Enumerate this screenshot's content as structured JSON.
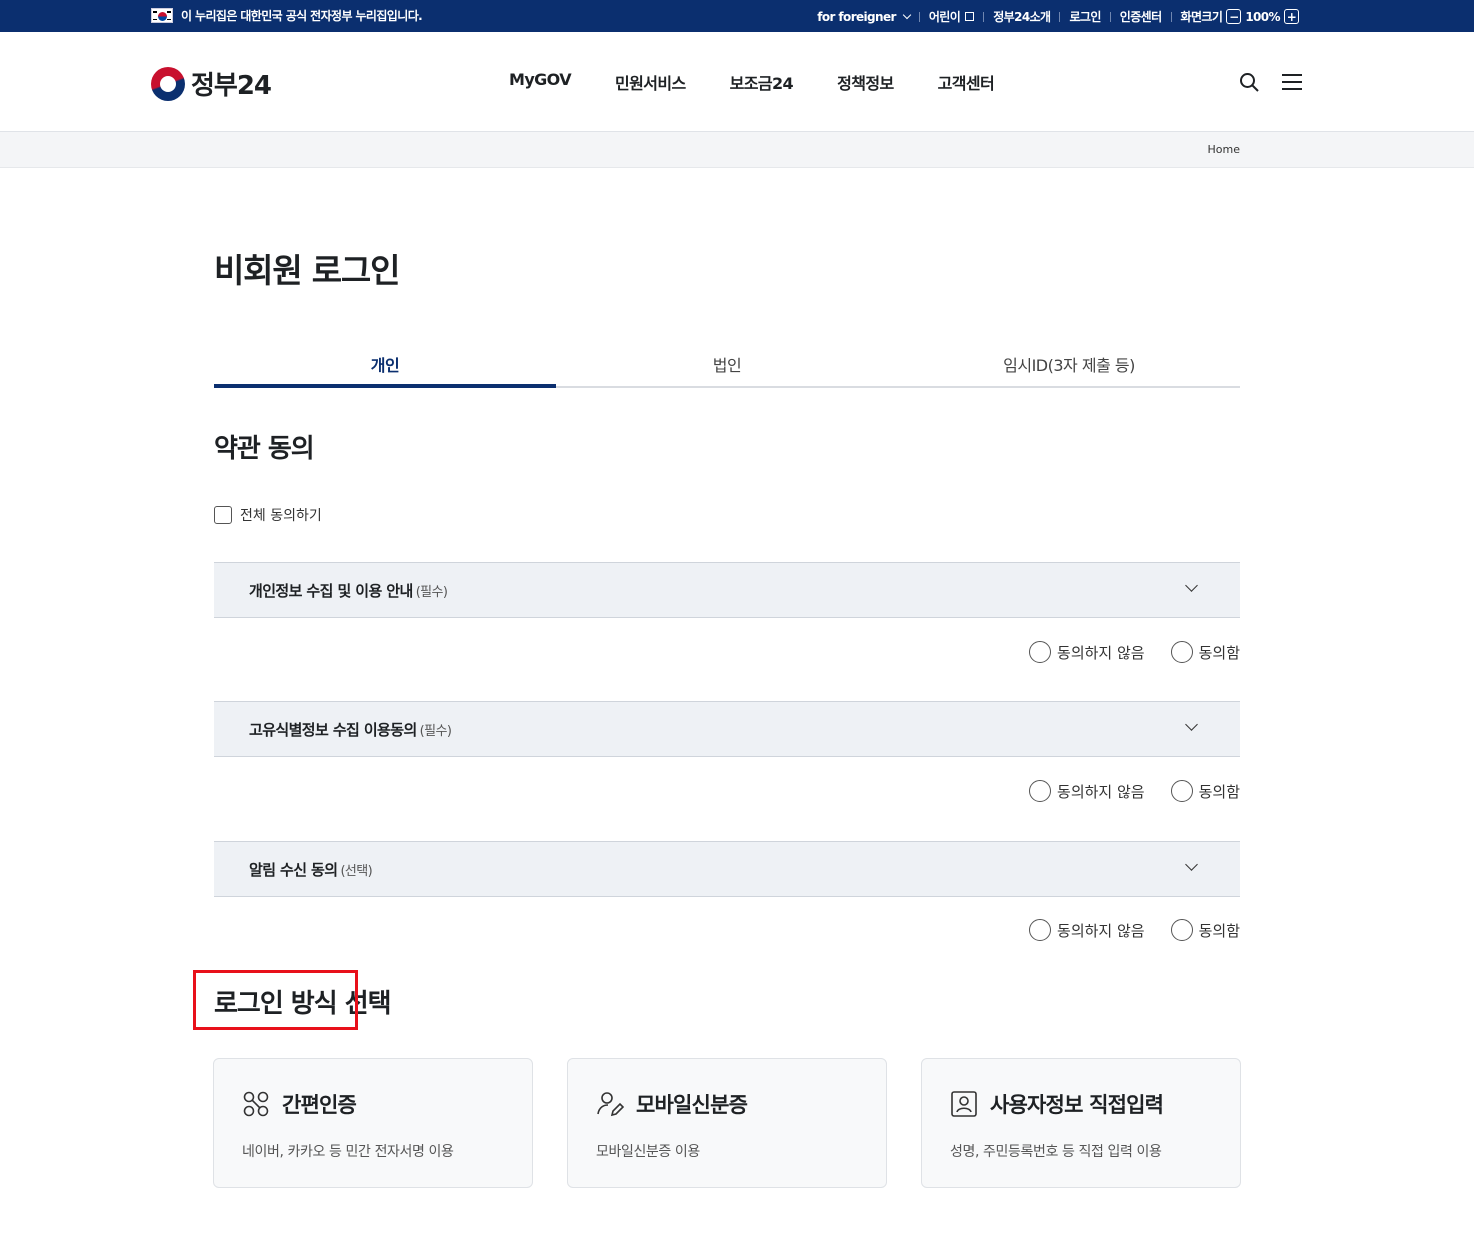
{
  "topbar": {
    "notice": "이 누리집은 대한민국 공식 전자정부 누리집입니다.",
    "links": [
      "for foreigner",
      "어린이",
      "정부24소개",
      "로그인",
      "인증센터",
      "화면크기"
    ],
    "zoom": "100%"
  },
  "header": {
    "logo": "정부24",
    "nav": [
      "MyGOV",
      "민원서비스",
      "보조금24",
      "정책정보",
      "고객센터"
    ]
  },
  "breadcrumb": {
    "home": "Home"
  },
  "page": {
    "title": "비회원 로그인",
    "tabs": [
      "개인",
      "법인",
      "임시ID(3자 제출 등)"
    ],
    "terms_heading": "약관 동의",
    "agree_all": "전체 동의하기",
    "terms": [
      {
        "label": "개인정보 수집 및 이용 안내",
        "tag": "(필수)"
      },
      {
        "label": "고유식별정보 수집 이용동의",
        "tag": "(필수)"
      },
      {
        "label": "알림 수신 동의",
        "tag": "(선택)"
      }
    ],
    "disagree": "동의하지 않음",
    "agree": "동의함",
    "login_heading": "로그인 방식 선택",
    "methods": [
      {
        "title": "간편인증",
        "desc": "네이버, 카카오 등 민간 전자서명 이용"
      },
      {
        "title": "모바일신분증",
        "desc": "모바일신분증 이용"
      },
      {
        "title": "사용자정보 직접입력",
        "desc": "성명, 주민등록번호 등 직접 입력 이용"
      }
    ]
  },
  "colors": {
    "brand": "#0b2f6f",
    "highlight": "#e8101a",
    "accordion_bg": "#eef1f5"
  }
}
